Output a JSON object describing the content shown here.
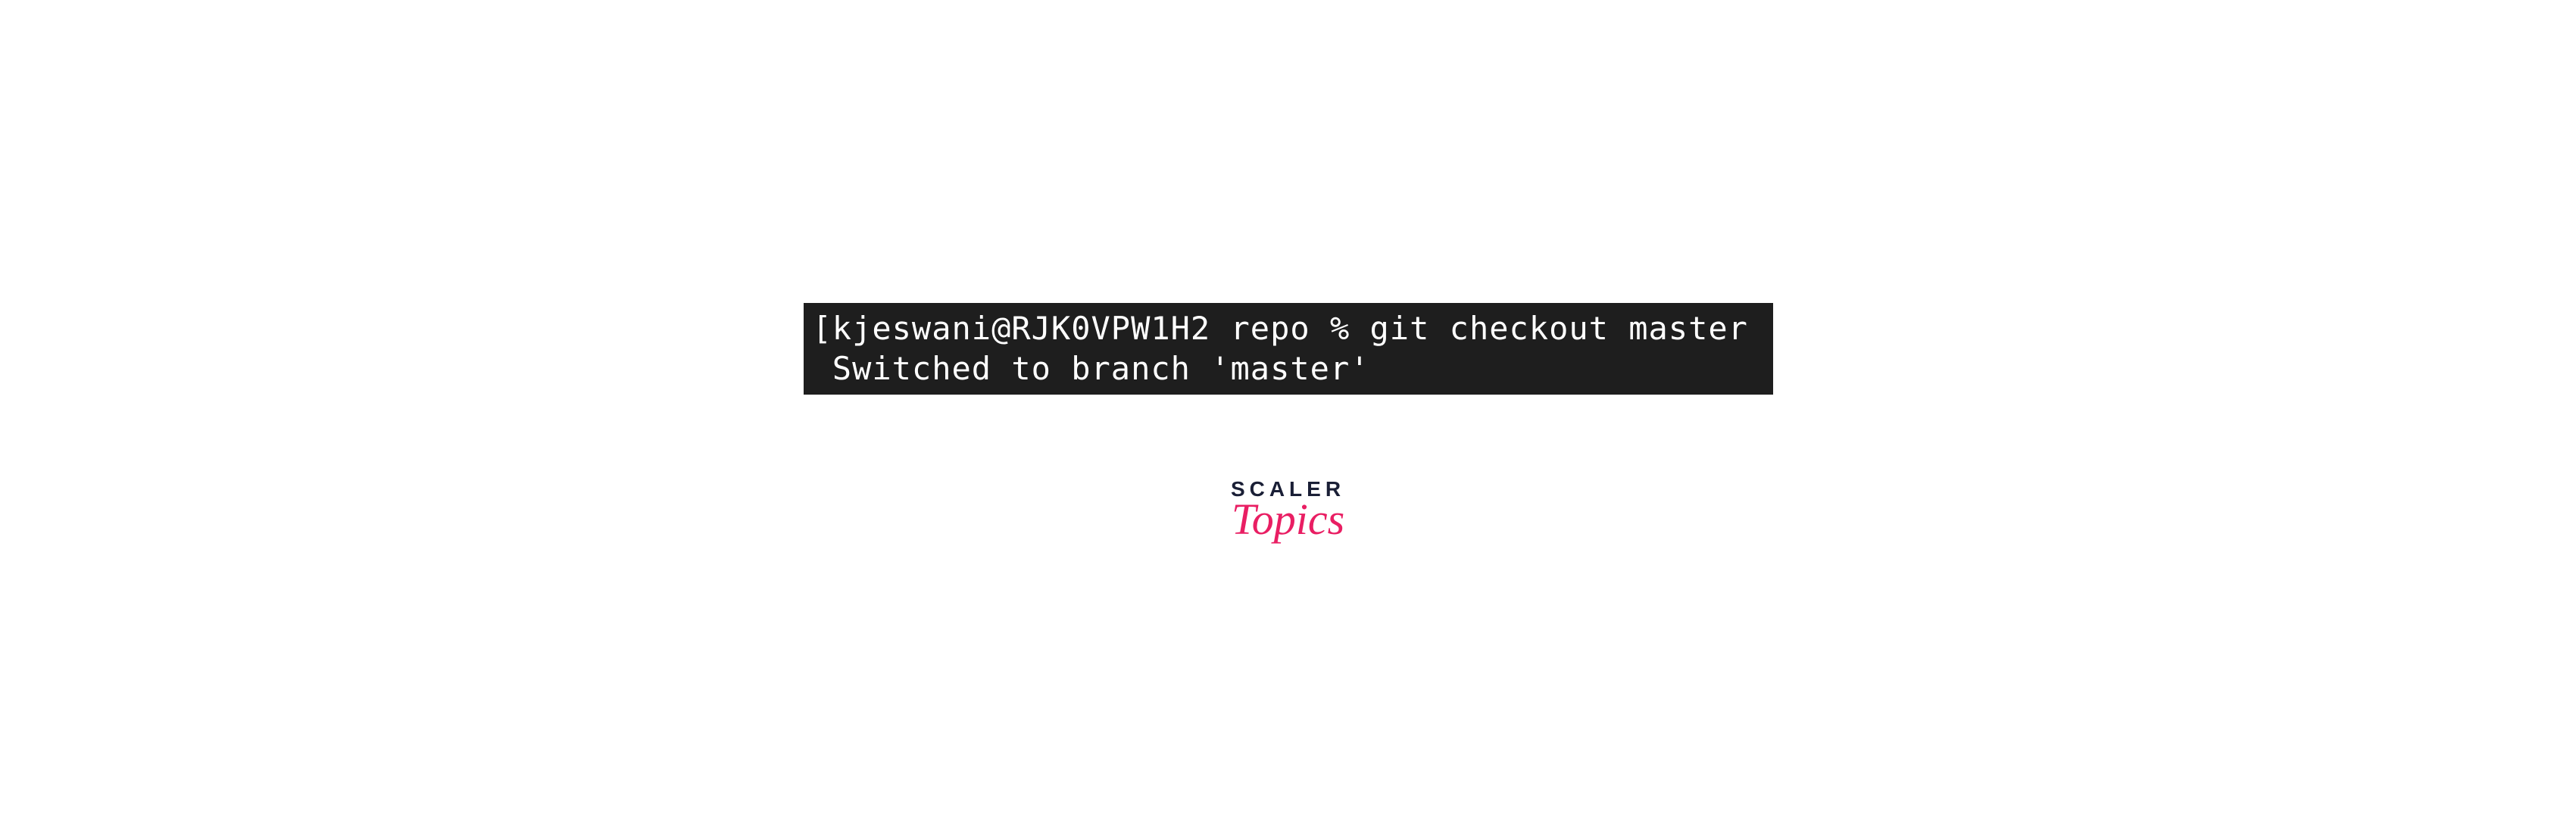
{
  "terminal": {
    "line1": "[kjeswani@RJK0VPW1H2 repo % git checkout master",
    "line2": " Switched to branch 'master'"
  },
  "logo": {
    "top": "SCALER",
    "bottom": "Topics"
  }
}
